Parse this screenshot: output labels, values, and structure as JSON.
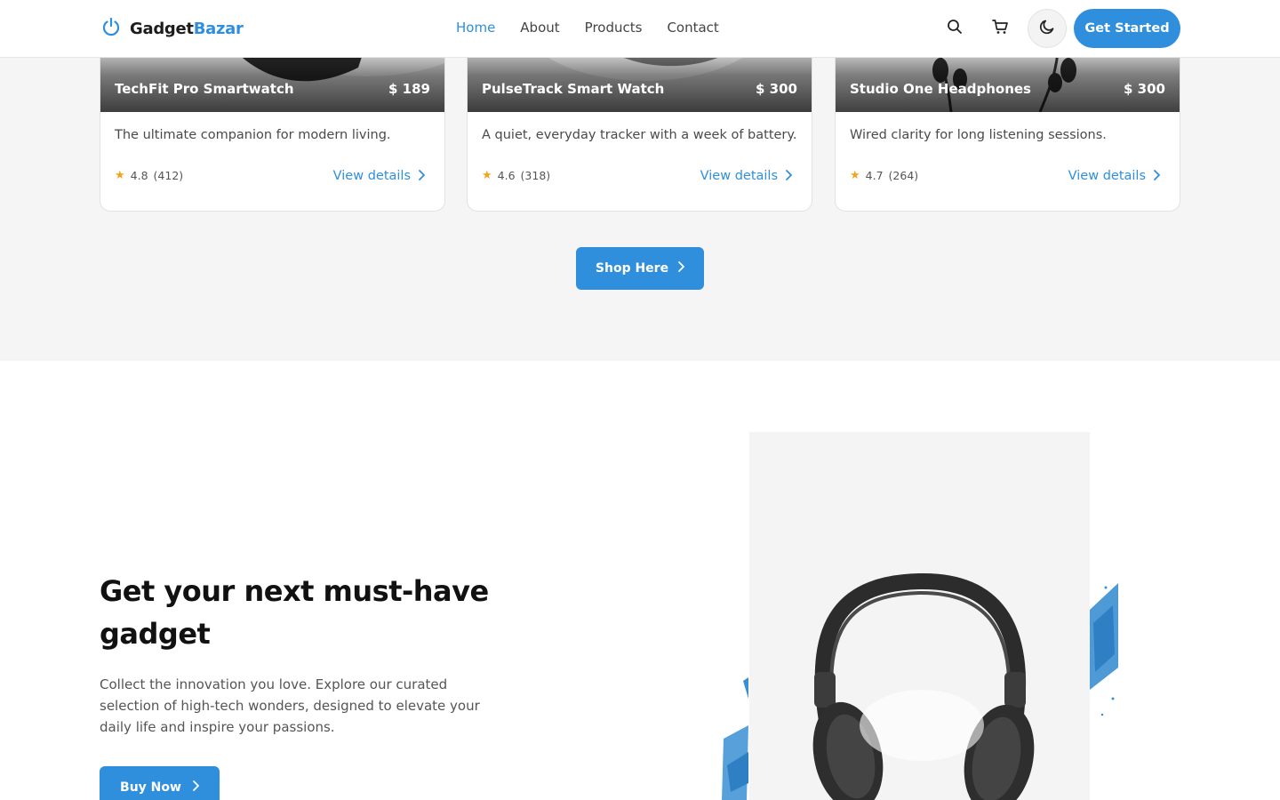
{
  "brand": {
    "name_part1": "Gadget",
    "name_part2": "Bazar"
  },
  "nav": {
    "items": [
      "Home",
      "About",
      "Products",
      "Contact"
    ],
    "active": "Home"
  },
  "header": {
    "cta_label": "Get Started"
  },
  "icons": {
    "logo": "power-icon",
    "search": "search-icon",
    "cart": "cart-icon",
    "theme": "moon-icon",
    "rating": "star-icon",
    "chevron": "chevron-right-icon"
  },
  "colors": {
    "accent": "#2f8fdc",
    "star": "#f2a51a",
    "section_bg": "#f5f5f5"
  },
  "products": [
    {
      "name": "TechFit Pro Smartwatch",
      "price": "$ 189",
      "description": "The ultimate companion for modern living.",
      "rating": "4.8",
      "reviews": "(412)",
      "link": "View details"
    },
    {
      "name": "PulseTrack Smart Watch",
      "price": "$ 300",
      "description": "A quiet, everyday tracker with a week of battery.",
      "rating": "4.6",
      "reviews": "(318)",
      "link": "View details"
    },
    {
      "name": "Studio One Headphones",
      "price": "$ 300",
      "description": "Wired clarity for long listening sessions.",
      "rating": "4.7",
      "reviews": "(264)",
      "link": "View details"
    }
  ],
  "shop": {
    "label": "Shop Here"
  },
  "hero": {
    "title": "Get your next must-have gadget",
    "text": "Collect the innovation you love. Explore our curated selection of high-tech wonders, designed to elevate your daily life and inspire your passions.",
    "button": "Buy Now"
  }
}
